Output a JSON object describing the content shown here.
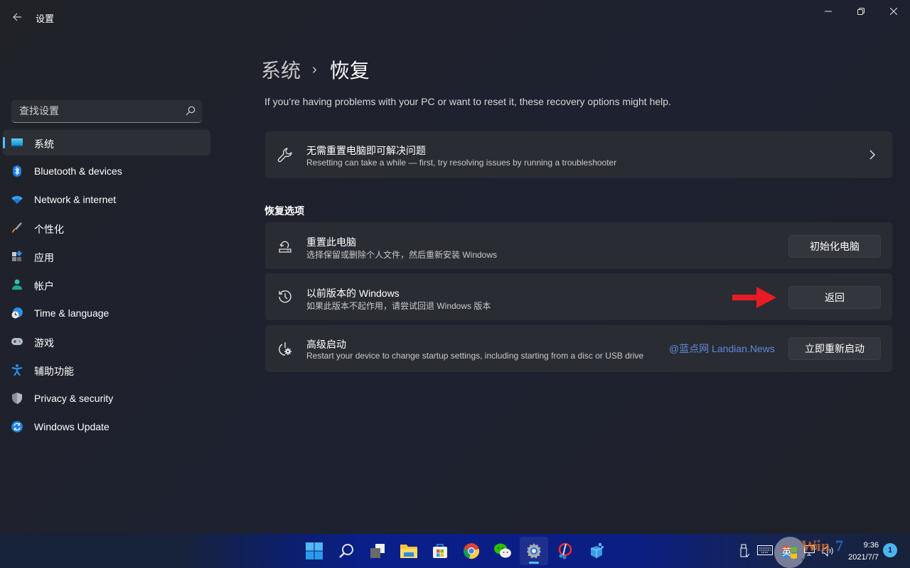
{
  "window": {
    "title": "设置",
    "controls": {
      "minimize": "minimize",
      "maximize": "maximize",
      "close": "close"
    }
  },
  "sidebar": {
    "search_placeholder": "查找设置",
    "items": [
      {
        "label": "系统",
        "icon": "system-icon",
        "active": true
      },
      {
        "label": "Bluetooth & devices",
        "icon": "bluetooth-icon",
        "active": false
      },
      {
        "label": "Network & internet",
        "icon": "wifi-icon",
        "active": false
      },
      {
        "label": "个性化",
        "icon": "brush-icon",
        "active": false
      },
      {
        "label": "应用",
        "icon": "apps-icon",
        "active": false
      },
      {
        "label": "帐户",
        "icon": "account-icon",
        "active": false
      },
      {
        "label": "Time & language",
        "icon": "time-language-icon",
        "active": false
      },
      {
        "label": "游戏",
        "icon": "gamepad-icon",
        "active": false
      },
      {
        "label": "辅助功能",
        "icon": "accessibility-icon",
        "active": false
      },
      {
        "label": "Privacy & security",
        "icon": "shield-icon",
        "active": false
      },
      {
        "label": "Windows Update",
        "icon": "update-icon",
        "active": false
      }
    ]
  },
  "main": {
    "breadcrumb": {
      "parent": "系统",
      "separator": "›",
      "current": "恢复"
    },
    "description": "If you’re having problems with your PC or want to reset it, these recovery options might help.",
    "troubleshoot_card": {
      "title": "无需重置电脑即可解决问题",
      "subtitle": "Resetting can take a while — first, try resolving issues by running a troubleshooter"
    },
    "section_title": "恢复选项",
    "options": [
      {
        "title": "重置此电脑",
        "subtitle": "选择保留或删除个人文件，然后重新安装 Windows",
        "button": "初始化电脑",
        "icon": "reset-pc-icon"
      },
      {
        "title": "以前版本的 Windows",
        "subtitle": "如果此版本不起作用，请尝试回退 Windows 版本",
        "button": "返回",
        "icon": "history-icon"
      },
      {
        "title": "高级启动",
        "subtitle": "Restart your device to change startup settings, including starting from a disc or USB drive",
        "button": "立即重新启动",
        "icon": "advanced-startup-icon"
      }
    ],
    "watermark": "@蓝点网 Landian.News"
  },
  "taskbar": {
    "apps": [
      "start",
      "search",
      "task-view",
      "file-explorer",
      "microsoft-store",
      "chrome",
      "wechat",
      "settings",
      "snipping-tool",
      "app-package"
    ],
    "active_app": "settings",
    "tray": {
      "ime": "英",
      "time": "9:36",
      "date": "2021/7/7",
      "notifications": "1"
    }
  },
  "colors": {
    "accent": "#4cc2ff",
    "arrow": "#e81c24",
    "watermark": "#5d8ad8"
  }
}
